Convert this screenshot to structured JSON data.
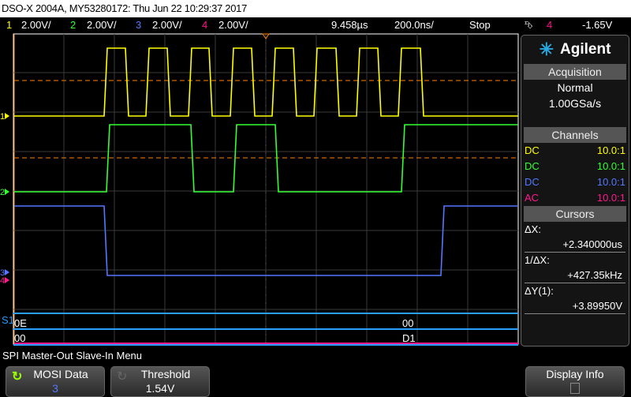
{
  "title": "DSO-X 2004A, MY53280172: Thu Jun 22 10:29:37 2017",
  "status": {
    "ch1": {
      "num": "1",
      "scale": "2.00V/",
      "color": "#ffff00"
    },
    "ch2": {
      "num": "2",
      "scale": "2.00V/",
      "color": "#33ff33"
    },
    "ch3": {
      "num": "3",
      "scale": "2.00V/",
      "color": "#5577ff"
    },
    "ch4": {
      "num": "4",
      "scale": "2.00V/",
      "color": "#ff1a8c"
    },
    "delay": "9.458µs",
    "timebase": "200.0ns/",
    "run_state": "Stop",
    "trigger_source": "4",
    "trigger_level": "-1.65V"
  },
  "decode": {
    "label": "S1",
    "row1": [
      "0E",
      "00"
    ],
    "row2": [
      "00",
      "D1"
    ]
  },
  "panel": {
    "brand": "Agilent",
    "acquisition": {
      "title": "Acquisition",
      "mode": "Normal",
      "rate": "1.00GSa/s"
    },
    "channels": {
      "title": "Channels",
      "rows": [
        {
          "coupling": "DC",
          "probe": "10.0:1",
          "color": "#ffff00"
        },
        {
          "coupling": "DC",
          "probe": "10.0:1",
          "color": "#33ff33"
        },
        {
          "coupling": "DC",
          "probe": "10.0:1",
          "color": "#5577ff"
        },
        {
          "coupling": "AC",
          "probe": "10.0:1",
          "color": "#ff1a8c"
        }
      ]
    },
    "cursors": {
      "title": "Cursors",
      "dx_label": "ΔX:",
      "dx": "+2.340000us",
      "inv_label": "1/ΔX:",
      "inv": "+427.35kHz",
      "dy_label": "ΔY(1):",
      "dy": "+3.89950V"
    }
  },
  "menu": {
    "title": "SPI Master-Out Slave-In Menu",
    "mosi_label": "MOSI Data",
    "mosi_value": "3",
    "threshold_label": "Threshold",
    "threshold_value": "1.54V",
    "display_info_label": "Display Info"
  }
}
